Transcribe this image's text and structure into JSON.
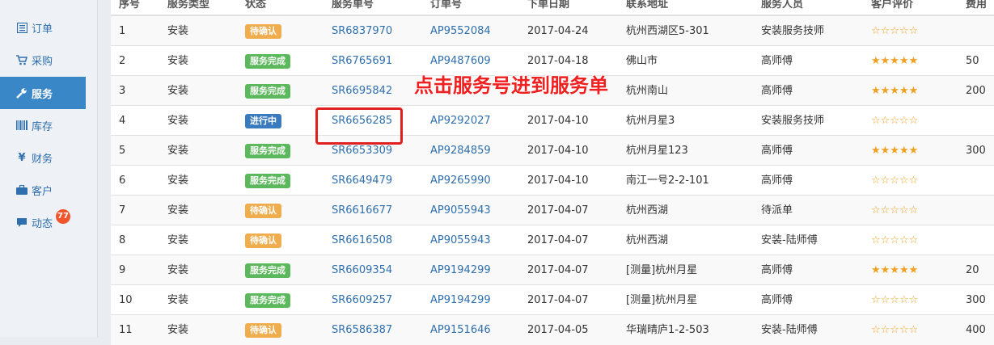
{
  "sidebar": {
    "items": [
      {
        "label": "订单",
        "icon": "list-icon"
      },
      {
        "label": "采购",
        "icon": "cart-icon"
      },
      {
        "label": "服务",
        "icon": "wrench-icon",
        "active": true
      },
      {
        "label": "库存",
        "icon": "barcode-icon"
      },
      {
        "label": "财务",
        "icon": "yen-icon"
      },
      {
        "label": "客户",
        "icon": "briefcase-icon"
      },
      {
        "label": "动态",
        "icon": "comment-icon",
        "badge": "77"
      }
    ]
  },
  "table": {
    "headers": [
      "序号",
      "服务类型",
      "状态",
      "服务单号",
      "订单号",
      "下单日期",
      "联系地址",
      "服务人员",
      "客户评价",
      "费用"
    ],
    "rows": [
      {
        "no": "1",
        "type": "安装",
        "status": "待确认",
        "status_kind": "pending",
        "service_no": "SR6837970",
        "order_no": "AP9552084",
        "date": "2017-04-24",
        "address": "杭州西湖区5-301",
        "staff": "安装服务技师",
        "stars": "☆☆☆☆☆",
        "fee": ""
      },
      {
        "no": "2",
        "type": "安装",
        "status": "服务完成",
        "status_kind": "done",
        "service_no": "SR6765691",
        "order_no": "AP9487609",
        "date": "2017-04-18",
        "address": "佛山市",
        "staff": "高师傅",
        "stars": "★★★★★",
        "fee": "50"
      },
      {
        "no": "3",
        "type": "安装",
        "status": "服务完成",
        "status_kind": "done",
        "service_no": "SR6695842",
        "order_no": "",
        "date": "",
        "address": "杭州南山",
        "staff": "高师傅",
        "stars": "★★★★★",
        "fee": "200"
      },
      {
        "no": "4",
        "type": "安装",
        "status": "进行中",
        "status_kind": "progress",
        "service_no": "SR6656285",
        "order_no": "AP9292027",
        "date": "2017-04-10",
        "address": "杭州月星3",
        "staff": "安装服务技师",
        "stars": "☆☆☆☆☆",
        "fee": ""
      },
      {
        "no": "5",
        "type": "安装",
        "status": "服务完成",
        "status_kind": "done",
        "service_no": "SR6653309",
        "order_no": "AP9284859",
        "date": "2017-04-10",
        "address": "杭州月星123",
        "staff": "高师傅",
        "stars": "★★★★★",
        "fee": "300"
      },
      {
        "no": "6",
        "type": "安装",
        "status": "服务完成",
        "status_kind": "done",
        "service_no": "SR6649479",
        "order_no": "AP9265990",
        "date": "2017-04-10",
        "address": "南江一号2-2-101",
        "staff": "高师傅",
        "stars": "☆☆☆☆☆",
        "fee": ""
      },
      {
        "no": "7",
        "type": "安装",
        "status": "待确认",
        "status_kind": "pending",
        "service_no": "SR6616677",
        "order_no": "AP9055943",
        "date": "2017-04-07",
        "address": "杭州西湖",
        "staff": "待派单",
        "stars": "☆☆☆☆☆",
        "fee": ""
      },
      {
        "no": "8",
        "type": "安装",
        "status": "待确认",
        "status_kind": "pending",
        "service_no": "SR6616508",
        "order_no": "AP9055943",
        "date": "2017-04-07",
        "address": "杭州西湖",
        "staff": "安装-陆师傅",
        "stars": "☆☆☆☆☆",
        "fee": ""
      },
      {
        "no": "9",
        "type": "安装",
        "status": "服务完成",
        "status_kind": "done",
        "service_no": "SR6609354",
        "order_no": "AP9194299",
        "date": "2017-04-07",
        "address": "[测量]杭州月星",
        "staff": "高师傅",
        "stars": "★★★★★",
        "fee": "20"
      },
      {
        "no": "10",
        "type": "安装",
        "status": "服务完成",
        "status_kind": "done",
        "service_no": "SR6609257",
        "order_no": "AP9194299",
        "date": "2017-04-07",
        "address": "[测量]杭州月星",
        "staff": "高师傅",
        "stars": "☆☆☆☆☆",
        "fee": "300"
      },
      {
        "no": "11",
        "type": "安装",
        "status": "待确认",
        "status_kind": "pending",
        "service_no": "SR6586387",
        "order_no": "AP9151646",
        "date": "2017-04-05",
        "address": "华瑞晴庐1-2-503",
        "staff": "安装-陆师傅",
        "stars": "☆☆☆☆☆",
        "fee": "400"
      }
    ]
  },
  "annotation": {
    "text": "点击服务号进到服务单"
  },
  "colors": {
    "accent": "#3a87c8",
    "link": "#2f6fad",
    "pending": "#f0ad4e",
    "done": "#5cb85c",
    "progress": "#3a7bbf",
    "annotation": "#e02020",
    "badge": "#f0552b"
  }
}
